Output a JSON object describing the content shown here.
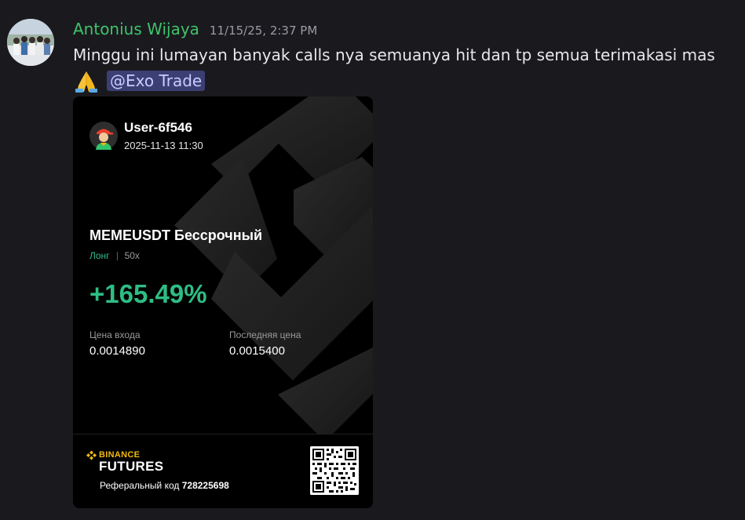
{
  "message": {
    "author": "Antonius Wijaya",
    "timestamp": "11/15/25, 2:37 PM",
    "text": "Minggu ini lumayan banyak calls nya semuanya hit dan tp semua terimakasi mas",
    "emoji": "folded-hands-emoji",
    "mention": "@Exo Trade",
    "author_color": "#3ec36c",
    "mention_bg": "#3b3f73"
  },
  "card": {
    "user": "User-6f546",
    "date": "2025-11-13 11:30",
    "symbol": "MEMEUSDT Бессрочный",
    "side": "Лонг",
    "leverage": "50x",
    "pnl": "+165.49%",
    "entry_label": "Цена входа",
    "entry_value": "0.0014890",
    "last_label": "Последняя цена",
    "last_value": "0.0015400",
    "brand_top": "BINANCE",
    "brand_bottom": "FUTURES",
    "referral_label": "Реферальный код",
    "referral_code": "728225698",
    "positive_color": "#2ebd85",
    "brand_color": "#f0b90b"
  }
}
